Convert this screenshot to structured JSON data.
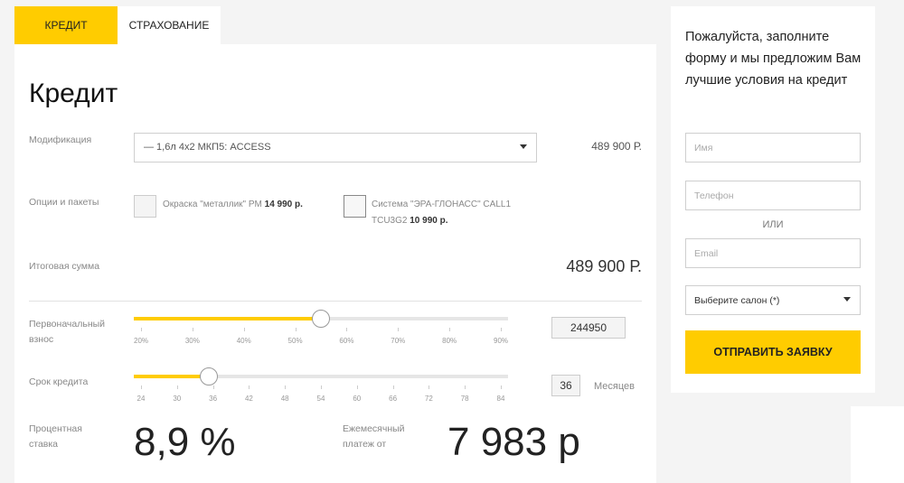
{
  "tabs": [
    {
      "label": "Кредит",
      "active": true
    },
    {
      "label": "Страхование",
      "active": false
    }
  ],
  "credit": {
    "title": "Кредит",
    "modification": {
      "label": "Модификация",
      "value": "— 1,6л 4х2 МКП5: ACCESS",
      "price": "489 900 Р."
    },
    "options": {
      "label": "Опции и пакеты",
      "items": [
        {
          "text": "Окраска \"металлик\" PM",
          "price": "14 990 р."
        },
        {
          "text_line1": "Система \"ЭРА-ГЛОНАСС\" CALL1",
          "text_line2": "TCU3G2",
          "price": "10 990 р."
        }
      ]
    },
    "total": {
      "label": "Итоговая сумма",
      "value": "489 900 Р."
    },
    "down_payment": {
      "label_line1": "Первоначальный",
      "label_line2": "взнос",
      "fraction": 0.5,
      "ticks": [
        "20%",
        "30%",
        "40%",
        "50%",
        "60%",
        "70%",
        "80%",
        "90%"
      ],
      "value": "244950"
    },
    "term": {
      "label": "Срок кредита",
      "fraction": 0.2,
      "ticks": [
        "24",
        "30",
        "36",
        "42",
        "48",
        "54",
        "60",
        "66",
        "72",
        "78",
        "84"
      ],
      "value": "36",
      "unit": "Месяцев"
    },
    "rate": {
      "label_line1": "Процентная",
      "label_line2": "ставка",
      "value": "8,9 %"
    },
    "monthly": {
      "label_line1": "Ежемесячный",
      "label_line2": "платеж от",
      "value": "7 983 р"
    }
  },
  "form": {
    "text": "Пожалуйста, заполните форму и мы предложим Вам лучшие условия на кредит",
    "name_placeholder": "Имя",
    "phone_placeholder": "Телефон",
    "or_label": "или",
    "email_placeholder": "Email",
    "salon_select": "Выберите салон (*)",
    "submit_label": "Отправить заявку"
  },
  "colors": {
    "accent": "#ffcc00"
  }
}
